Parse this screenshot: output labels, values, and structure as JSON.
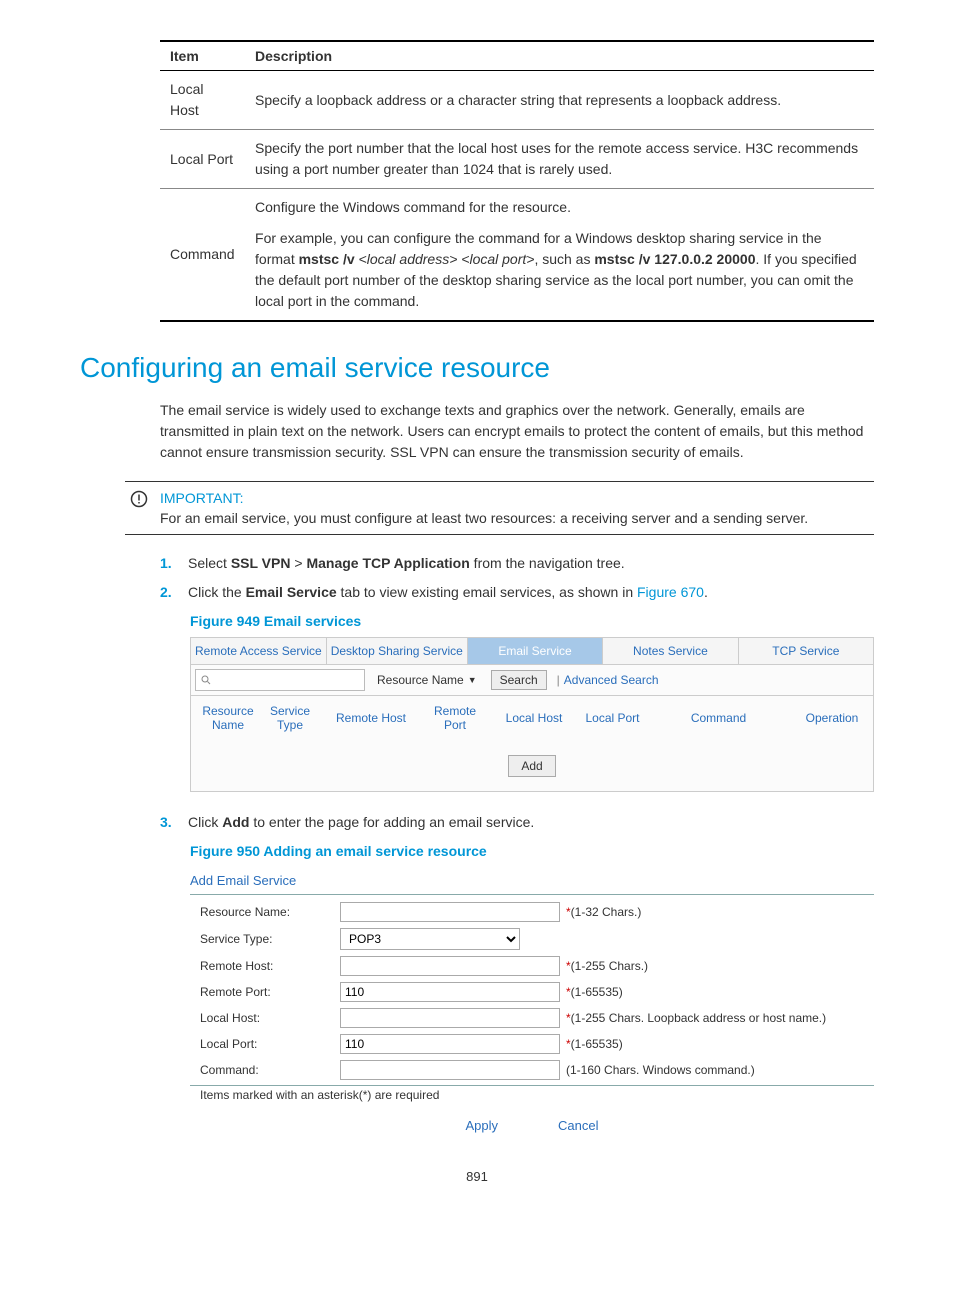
{
  "def_table": {
    "headers": {
      "item": "Item",
      "desc": "Description"
    },
    "rows": [
      {
        "item": "Local Host",
        "desc": "Specify a loopback address or a character string that represents a loopback address."
      },
      {
        "item": "Local Port",
        "desc": "Specify the port number that the local host uses for the remote access service. H3C recommends using a port number greater than 1024 that is rarely used."
      },
      {
        "item": "Command",
        "desc_line1": "Configure the Windows command for the resource.",
        "desc_p2_a": "For example, you can configure the command for a Windows desktop sharing service in the format ",
        "desc_p2_b": "mstsc /v",
        "desc_p2_c": " <local address> <local port>",
        "desc_p2_d": ", such as ",
        "desc_p2_e": "mstsc /v 127.0.0.2 20000",
        "desc_p2_f": ". If you specified the default port number of the desktop sharing service as the local port number, you can omit the local port in the command."
      }
    ]
  },
  "section_title": "Configuring an email service resource",
  "intro": "The email service is widely used to exchange texts and graphics over the network. Generally, emails are transmitted in plain text on the network. Users can encrypt emails to protect the content of emails, but this method cannot ensure transmission security. SSL VPN can ensure the transmission security of emails.",
  "admon": {
    "title": "IMPORTANT:",
    "body": "For an email service, you must configure at least two resources: a receiving server and a sending server."
  },
  "steps": {
    "s1_a": "Select ",
    "s1_b": "SSL VPN",
    "s1_c": " > ",
    "s1_d": "Manage TCP Application",
    "s1_e": " from the navigation tree.",
    "s2_a": "Click the ",
    "s2_b": "Email Service",
    "s2_c": " tab to view existing email services, as shown in ",
    "s2_link": "Figure 670",
    "s2_d": ".",
    "s3_a": "Click ",
    "s3_b": "Add",
    "s3_c": " to enter the page for adding an email service."
  },
  "fig1_caption": "Figure 949 Email services",
  "fig2_caption": "Figure 950 Adding an email service resource",
  "ui1": {
    "tabs": [
      "Remote Access Service",
      "Desktop Sharing Service",
      "Email Service",
      "Notes Service",
      "TCP Service"
    ],
    "search_field_label": "Resource Name",
    "search_btn": "Search",
    "adv_search": "Advanced Search",
    "cols": {
      "rn": "Resource Name",
      "st": "Service Type",
      "rh": "Remote Host",
      "rp": "Remote Port",
      "lh": "Local Host",
      "lp": "Local Port",
      "cmd": "Command",
      "op": "Operation"
    },
    "add_btn": "Add"
  },
  "ui2": {
    "title": "Add Email Service",
    "fields": {
      "resource_name": {
        "label": "Resource Name:",
        "value": "",
        "hint": "(1-32 Chars.)",
        "req": "*"
      },
      "service_type": {
        "label": "Service Type:",
        "value": "POP3"
      },
      "remote_host": {
        "label": "Remote Host:",
        "value": "",
        "hint": "(1-255 Chars.)",
        "req": "*"
      },
      "remote_port": {
        "label": "Remote Port:",
        "value": "110",
        "hint": "(1-65535)",
        "req": "*"
      },
      "local_host": {
        "label": "Local Host:",
        "value": "",
        "hint": "(1-255 Chars. Loopback address or host name.)",
        "req": "*"
      },
      "local_port": {
        "label": "Local Port:",
        "value": "110",
        "hint": "(1-65535)",
        "req": "*"
      },
      "command": {
        "label": "Command:",
        "value": "",
        "hint": "(1-160 Chars. Windows command.)"
      }
    },
    "req_note": "Items marked with an asterisk(*) are required",
    "apply": "Apply",
    "cancel": "Cancel"
  },
  "page_num": "891"
}
